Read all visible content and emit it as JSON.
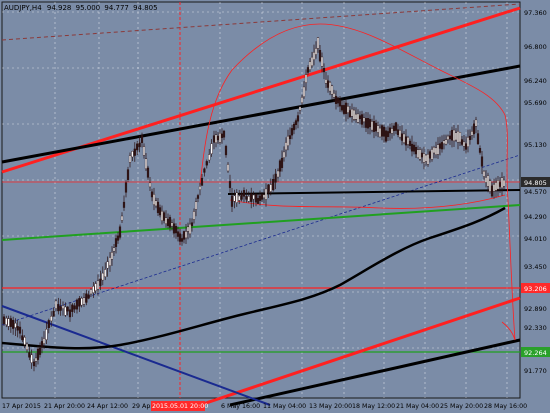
{
  "window": {
    "symbol_label": "AUDJPY,H4",
    "quote_open": "94.928",
    "quote_high": "95.000",
    "quote_low": "94.777",
    "quote_close": "94.805"
  },
  "y_axis": {
    "ticks": [
      "97.360",
      "96.800",
      "96.240",
      "95.690",
      "95.130",
      "94.570",
      "94.290",
      "94.010",
      "93.450",
      "92.890",
      "92.330",
      "91.770"
    ],
    "price_labels": [
      {
        "value": "94.805",
        "color": "#ffffff",
        "bg": "#2b2b2b"
      },
      {
        "value": "93.206",
        "color": "#ffffff",
        "bg": "#ff2a2a"
      },
      {
        "value": "92.264",
        "color": "#ffffff",
        "bg": "#2aa02a"
      }
    ]
  },
  "x_axis": {
    "ticks": [
      "17 Apr 2015",
      "21 Apr 20:00",
      "24 Apr 12:00",
      "29 Ap",
      "6 May 16:00",
      "11 May 04:00",
      "13 May 20:00",
      "18 May 12:00",
      "21 May 04:00",
      "25 May 20:00",
      "28 May 16:00"
    ],
    "highlight": "2015.05.01 20:00"
  },
  "colors": {
    "background": "#7b8ca7",
    "axis_panel": "#7b8ca7",
    "candle_body": "#b08080",
    "candle_wick": "#2b1010",
    "trend_red": "#ff2020",
    "trend_black": "#000000",
    "ma_green": "#20a020",
    "channel_blue": "#1a2a90"
  }
}
